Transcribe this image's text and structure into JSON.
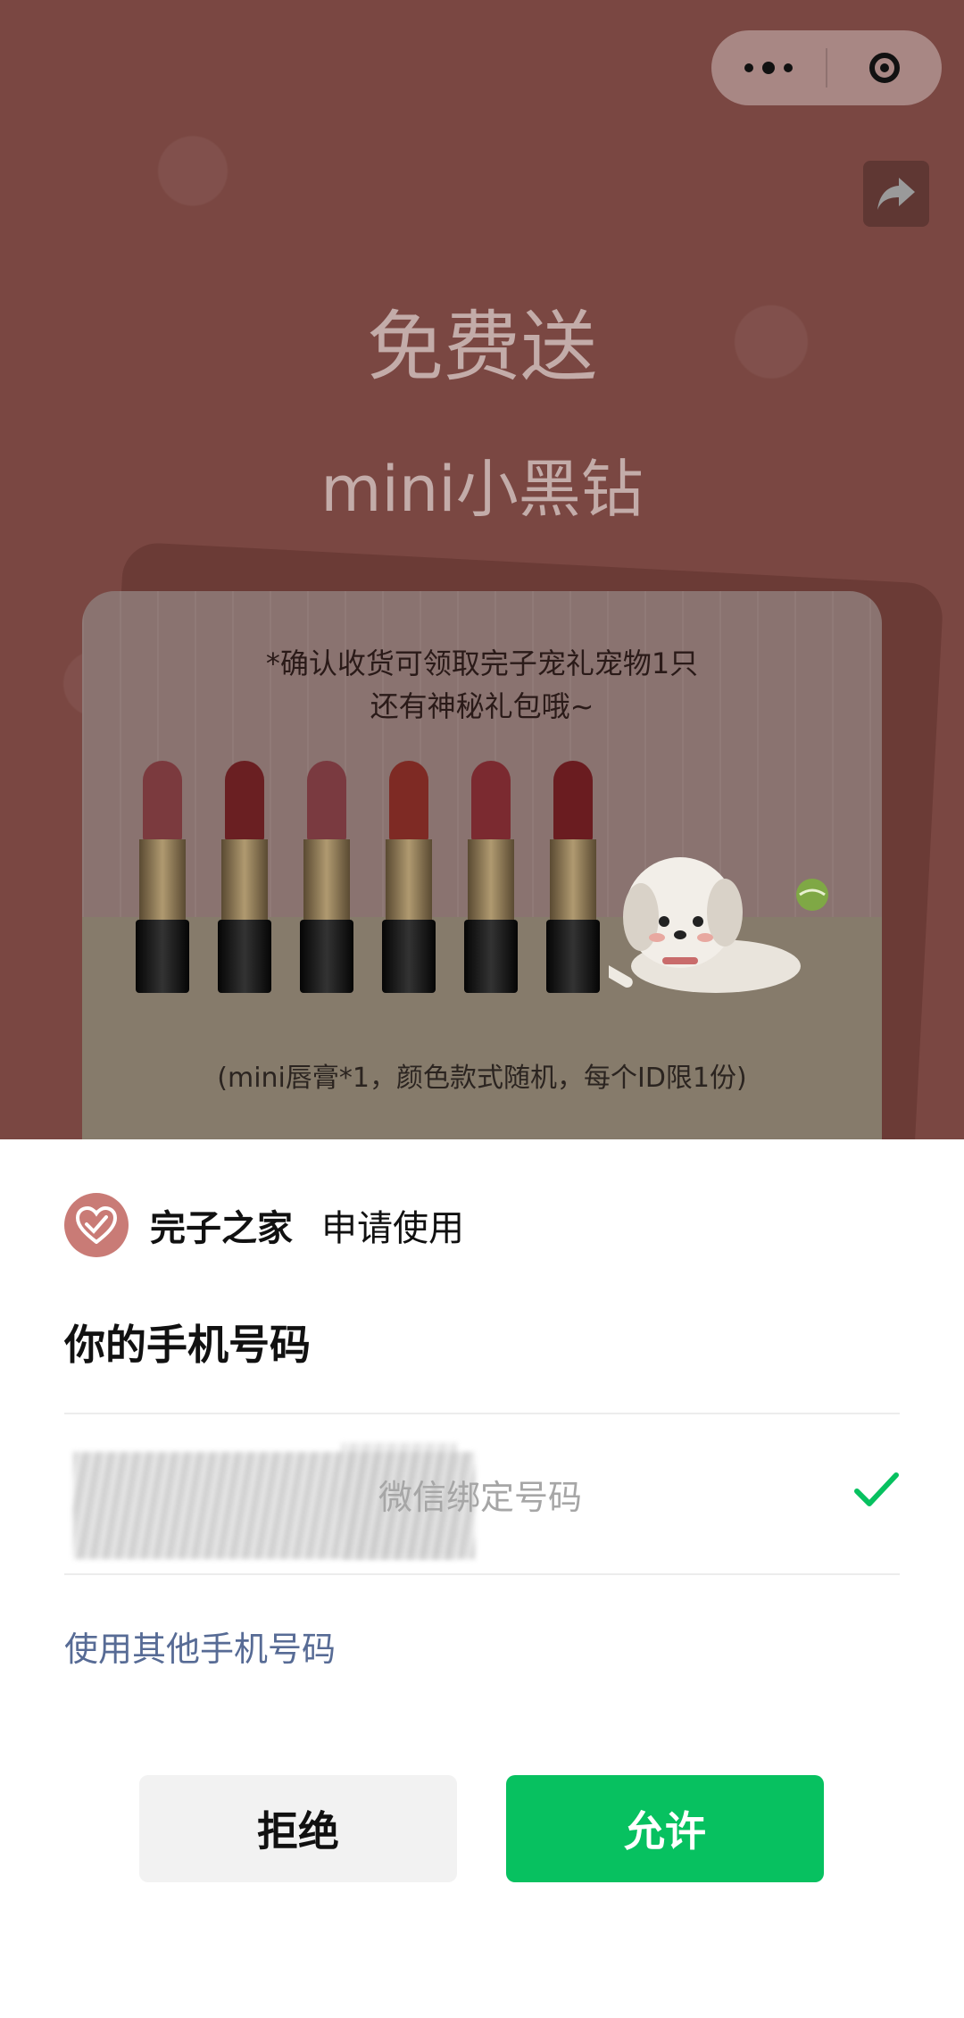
{
  "background_page": {
    "title": "免费送",
    "subtitle": "mini小黑钻",
    "card": {
      "line1": "*确认收货可领取完子宠礼宠物1只",
      "line2": "还有神秘礼包哦~",
      "note": "(mini唇膏*1，颜色款式随机，每个ID限1份)"
    },
    "lipstick_colors": [
      "#7b3a3e",
      "#6a1f22",
      "#7a3a40",
      "#7e2a24",
      "#7b2a30",
      "#6a1c20"
    ]
  },
  "auth_sheet": {
    "app_name": "完子之家",
    "request_text": "申请使用",
    "permission_title": "你的手机号码",
    "phone_label": "微信绑定号码",
    "other_phone_link": "使用其他手机号码",
    "reject_label": "拒绝",
    "allow_label": "允许"
  },
  "colors": {
    "allow_button": "#07c160",
    "link": "#576b95",
    "check": "#07c160"
  }
}
